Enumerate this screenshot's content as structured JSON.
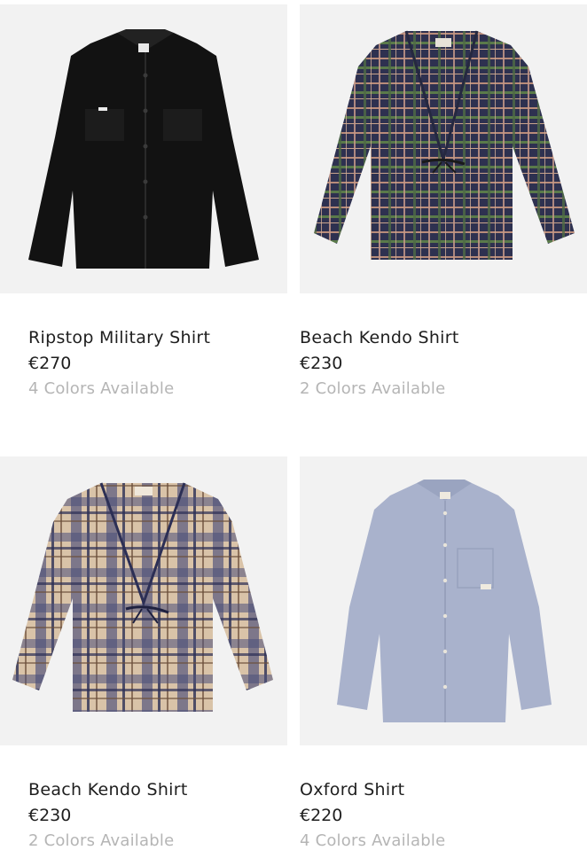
{
  "products": [
    {
      "name": "Ripstop Military Shirt",
      "price": "€270",
      "colors": "4 Colors Available",
      "image": "black-military-shirt"
    },
    {
      "name": "Beach Kendo Shirt",
      "price": "€230",
      "colors": "2 Colors Available",
      "image": "navy-plaid-kendo-shirt"
    },
    {
      "name": "Beach Kendo Shirt",
      "price": "€230",
      "colors": "2 Colors Available",
      "image": "beige-plaid-kendo-shirt"
    },
    {
      "name": "Oxford Shirt",
      "price": "€220",
      "colors": "4 Colors Available",
      "image": "light-blue-oxford-shirt"
    }
  ]
}
